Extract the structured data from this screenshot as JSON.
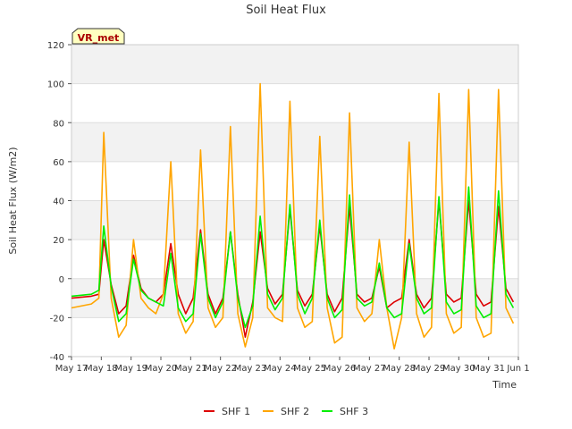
{
  "chart_data": {
    "type": "line",
    "title": "Soil Heat Flux",
    "xlabel": "Time",
    "ylabel": "Soil Heat Flux (W/m2)",
    "ylim": [
      -40,
      120
    ],
    "y_ticks": [
      -40,
      -20,
      0,
      20,
      40,
      60,
      80,
      100,
      120
    ],
    "xlim": [
      "May 17",
      "Jun 1"
    ],
    "x_tick_labels": [
      "May 17",
      "May 18",
      "May 19",
      "May 20",
      "May 21",
      "May 22",
      "May 23",
      "May 24",
      "May 25",
      "May 26",
      "May 27",
      "May 28",
      "May 29",
      "May 30",
      "May 31",
      "Jun 1"
    ],
    "grid": true,
    "banded_background": true,
    "legend_position": "bottom-center",
    "site_label": "VR_met",
    "series": [
      {
        "name": "SHF 1",
        "color": "#dd0000",
        "x": [
          "May 17 00:00",
          "May 17 16:00",
          "May 17 22:00",
          "May 18 02:00",
          "May 18 08:00",
          "May 18 14:00",
          "May 18 20:00",
          "May 19 02:00",
          "May 19 08:00",
          "May 19 14:00",
          "May 19 20:00",
          "May 20 02:00",
          "May 20 08:00",
          "May 20 14:00",
          "May 20 20:00",
          "May 21 02:00",
          "May 21 08:00",
          "May 21 14:00",
          "May 21 20:00",
          "May 22 02:00",
          "May 22 08:00",
          "May 22 14:00",
          "May 22 20:00",
          "May 23 02:00",
          "May 23 08:00",
          "May 23 14:00",
          "May 23 20:00",
          "May 24 02:00",
          "May 24 08:00",
          "May 24 14:00",
          "May 24 20:00",
          "May 25 02:00",
          "May 25 08:00",
          "May 25 14:00",
          "May 25 20:00",
          "May 26 02:00",
          "May 26 08:00",
          "May 26 14:00",
          "May 26 20:00",
          "May 27 02:00",
          "May 27 08:00",
          "May 27 14:00",
          "May 27 20:00",
          "May 28 02:00",
          "May 28 08:00",
          "May 28 14:00",
          "May 28 20:00",
          "May 29 02:00",
          "May 29 08:00",
          "May 29 14:00",
          "May 29 20:00",
          "May 30 02:00",
          "May 30 08:00",
          "May 30 14:00",
          "May 30 20:00",
          "May 31 02:00",
          "May 31 08:00",
          "May 31 14:00",
          "May 31 20:00"
        ],
        "y": [
          -10,
          -9,
          -8,
          20,
          -3,
          -18,
          -14,
          12,
          -5,
          -10,
          -12,
          -8,
          18,
          -8,
          -18,
          -10,
          25,
          -8,
          -18,
          -10,
          24,
          -8,
          -30,
          -12,
          24,
          -5,
          -13,
          -8,
          36,
          -6,
          -14,
          -8,
          27,
          -8,
          -17,
          -10,
          37,
          -8,
          -12,
          -10,
          6,
          -15,
          -12,
          -10,
          20,
          -8,
          -15,
          -10,
          40,
          -8,
          -12,
          -10,
          40,
          -8,
          -14,
          -12,
          37,
          -5,
          -12
        ]
      },
      {
        "name": "SHF 2",
        "color": "#ffa500",
        "x": [
          "May 17 00:00",
          "May 17 16:00",
          "May 17 22:00",
          "May 18 02:00",
          "May 18 08:00",
          "May 18 14:00",
          "May 18 20:00",
          "May 19 02:00",
          "May 19 08:00",
          "May 19 14:00",
          "May 19 20:00",
          "May 20 02:00",
          "May 20 08:00",
          "May 20 14:00",
          "May 20 20:00",
          "May 21 02:00",
          "May 21 08:00",
          "May 21 14:00",
          "May 21 20:00",
          "May 22 02:00",
          "May 22 08:00",
          "May 22 14:00",
          "May 22 20:00",
          "May 23 02:00",
          "May 23 08:00",
          "May 23 14:00",
          "May 23 20:00",
          "May 24 02:00",
          "May 24 08:00",
          "May 24 14:00",
          "May 24 20:00",
          "May 25 02:00",
          "May 25 08:00",
          "May 25 14:00",
          "May 25 20:00",
          "May 26 02:00",
          "May 26 08:00",
          "May 26 14:00",
          "May 26 20:00",
          "May 27 02:00",
          "May 27 08:00",
          "May 27 14:00",
          "May 27 20:00",
          "May 28 02:00",
          "May 28 08:00",
          "May 28 14:00",
          "May 28 20:00",
          "May 29 02:00",
          "May 29 08:00",
          "May 29 14:00",
          "May 29 20:00",
          "May 30 02:00",
          "May 30 08:00",
          "May 30 14:00",
          "May 30 20:00",
          "May 31 02:00",
          "May 31 08:00",
          "May 31 14:00",
          "May 31 20:00"
        ],
        "y": [
          -15,
          -13,
          -10,
          75,
          -10,
          -30,
          -24,
          20,
          -10,
          -15,
          -18,
          -8,
          60,
          -18,
          -28,
          -22,
          66,
          -15,
          -25,
          -20,
          78,
          -18,
          -35,
          -20,
          100,
          -15,
          -20,
          -22,
          91,
          -15,
          -25,
          -22,
          73,
          -15,
          -33,
          -30,
          85,
          -15,
          -22,
          -18,
          20,
          -15,
          -36,
          -20,
          70,
          -18,
          -30,
          -25,
          95,
          -18,
          -28,
          -25,
          97,
          -20,
          -30,
          -28,
          97,
          -15,
          -23
        ]
      },
      {
        "name": "SHF 3",
        "color": "#00ee00",
        "x": [
          "May 17 00:00",
          "May 17 16:00",
          "May 17 22:00",
          "May 18 02:00",
          "May 18 08:00",
          "May 18 14:00",
          "May 18 20:00",
          "May 19 02:00",
          "May 19 08:00",
          "May 19 14:00",
          "May 19 20:00",
          "May 20 02:00",
          "May 20 08:00",
          "May 20 14:00",
          "May 20 20:00",
          "May 21 02:00",
          "May 21 08:00",
          "May 21 14:00",
          "May 21 20:00",
          "May 22 02:00",
          "May 22 08:00",
          "May 22 14:00",
          "May 22 20:00",
          "May 23 02:00",
          "May 23 08:00",
          "May 23 14:00",
          "May 23 20:00",
          "May 24 02:00",
          "May 24 08:00",
          "May 24 14:00",
          "May 24 20:00",
          "May 25 02:00",
          "May 25 08:00",
          "May 25 14:00",
          "May 25 20:00",
          "May 26 02:00",
          "May 26 08:00",
          "May 26 14:00",
          "May 26 20:00",
          "May 27 02:00",
          "May 27 08:00",
          "May 27 14:00",
          "May 27 20:00",
          "May 28 02:00",
          "May 28 08:00",
          "May 28 14:00",
          "May 28 20:00",
          "May 29 02:00",
          "May 29 08:00",
          "May 29 14:00",
          "May 29 20:00",
          "May 30 02:00",
          "May 30 08:00",
          "May 30 14:00",
          "May 30 20:00",
          "May 31 02:00",
          "May 31 08:00",
          "May 31 14:00",
          "May 31 20:00"
        ],
        "y": [
          -9,
          -8,
          -6,
          27,
          -4,
          -22,
          -18,
          10,
          -6,
          -10,
          -12,
          -14,
          13,
          -15,
          -22,
          -18,
          23,
          -10,
          -20,
          -12,
          24,
          -10,
          -25,
          -14,
          32,
          -8,
          -16,
          -10,
          38,
          -8,
          -18,
          -10,
          30,
          -10,
          -20,
          -16,
          43,
          -10,
          -14,
          -12,
          8,
          -15,
          -20,
          -18,
          18,
          -10,
          -18,
          -15,
          42,
          -12,
          -18,
          -16,
          47,
          -14,
          -20,
          -18,
          45,
          -8,
          -15
        ]
      }
    ]
  }
}
